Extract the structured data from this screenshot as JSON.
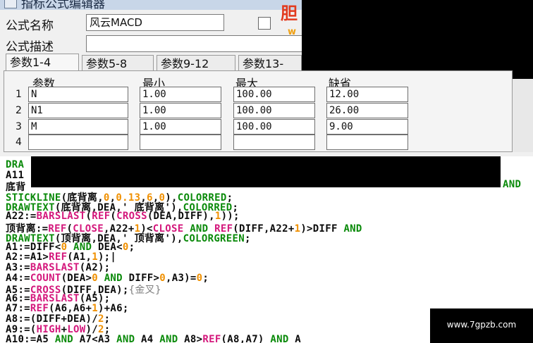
{
  "window": {
    "title": "指标公式编辑器"
  },
  "form": {
    "name_label": "公式名称",
    "name_value": "风云MACD",
    "desc_label": "公式描述",
    "desc_value": ""
  },
  "logo": {
    "text_red": "胆",
    "text_gold": "w"
  },
  "tabs": [
    {
      "label": "参数1-4",
      "active": true
    },
    {
      "label": "参数5-8",
      "active": false
    },
    {
      "label": "参数9-12",
      "active": false
    },
    {
      "label": "参数13-",
      "active": false
    }
  ],
  "params": {
    "headers": [
      "参数",
      "最小",
      "最大",
      "缺省"
    ],
    "rows": [
      {
        "num": "1",
        "name": "N",
        "min": "1.00",
        "max": "100.00",
        "default": "12.00"
      },
      {
        "num": "2",
        "name": "N1",
        "min": "1.00",
        "max": "100.00",
        "default": "26.00"
      },
      {
        "num": "3",
        "name": "M",
        "min": "1.00",
        "max": "100.00",
        "default": "9.00"
      },
      {
        "num": "4",
        "name": "",
        "min": "",
        "max": "",
        "default": ""
      }
    ]
  },
  "colors": {
    "keyword": "#0a8a0a",
    "operator": "#0a0a0a",
    "function": "#d4187c",
    "number": "#f09000",
    "string": "#111111",
    "builtin_color": "#0a8a0a",
    "comment": "#808080"
  },
  "code": {
    "lines": [
      [
        {
          "t": "DRA",
          "c": "keyword"
        }
      ],
      [
        {
          "t": "A11",
          "c": "operator"
        }
      ],
      [
        {
          "t": "底背",
          "c": "operator"
        }
      ],
      [
        {
          "t": "STICKLINE",
          "c": "keyword"
        },
        {
          "t": "(底背离,",
          "c": "operator"
        },
        {
          "t": "0",
          "c": "number"
        },
        {
          "t": ",",
          "c": "operator"
        },
        {
          "t": "0.13",
          "c": "number"
        },
        {
          "t": ",",
          "c": "operator"
        },
        {
          "t": "6",
          "c": "number"
        },
        {
          "t": ",",
          "c": "operator"
        },
        {
          "t": "0",
          "c": "number"
        },
        {
          "t": "),",
          "c": "operator"
        },
        {
          "t": "COLORRED",
          "c": "builtin_color"
        },
        {
          "t": ";",
          "c": "operator"
        }
      ],
      [
        {
          "t": "DRAWTEXT",
          "c": "keyword"
        },
        {
          "t": "(底背离,DEA,' 底背离'),",
          "c": "operator"
        },
        {
          "t": "COLORRED",
          "c": "builtin_color"
        },
        {
          "t": ";",
          "c": "operator"
        }
      ],
      [
        {
          "t": "A22:=",
          "c": "operator"
        },
        {
          "t": "BARSLAST",
          "c": "function"
        },
        {
          "t": "(",
          "c": "operator"
        },
        {
          "t": "REF",
          "c": "function"
        },
        {
          "t": "(",
          "c": "operator"
        },
        {
          "t": "CROSS",
          "c": "function"
        },
        {
          "t": "(DEA,DIFF),",
          "c": "operator"
        },
        {
          "t": "1",
          "c": "number"
        },
        {
          "t": "));",
          "c": "operator"
        }
      ],
      [
        {
          "t": "顶背离:=",
          "c": "operator"
        },
        {
          "t": "REF",
          "c": "function"
        },
        {
          "t": "(",
          "c": "operator"
        },
        {
          "t": "CLOSE",
          "c": "function"
        },
        {
          "t": ",A22+",
          "c": "operator"
        },
        {
          "t": "1",
          "c": "number"
        },
        {
          "t": ")<",
          "c": "operator"
        },
        {
          "t": "CLOSE",
          "c": "function"
        },
        {
          "t": " ",
          "c": "operator"
        },
        {
          "t": "AND",
          "c": "keyword"
        },
        {
          "t": " ",
          "c": "operator"
        },
        {
          "t": "REF",
          "c": "function"
        },
        {
          "t": "(DIFF,A22+",
          "c": "operator"
        },
        {
          "t": "1",
          "c": "number"
        },
        {
          "t": ")>DIFF ",
          "c": "operator"
        },
        {
          "t": "AND",
          "c": "keyword"
        }
      ],
      [
        {
          "t": "DRAWTEXT",
          "c": "keyword"
        },
        {
          "t": "(顶背离,DEA,' 顶背离'),",
          "c": "operator"
        },
        {
          "t": "COLORGREEN",
          "c": "builtin_color"
        },
        {
          "t": ";",
          "c": "operator"
        }
      ],
      [
        {
          "t": "A1:=DIFF<",
          "c": "operator"
        },
        {
          "t": "0",
          "c": "number"
        },
        {
          "t": " ",
          "c": "operator"
        },
        {
          "t": "AND",
          "c": "keyword"
        },
        {
          "t": " DEA<",
          "c": "operator"
        },
        {
          "t": "0",
          "c": "number"
        },
        {
          "t": ";",
          "c": "operator"
        }
      ],
      [
        {
          "t": "A2:=A1>",
          "c": "operator"
        },
        {
          "t": "REF",
          "c": "function"
        },
        {
          "t": "(A1,",
          "c": "operator"
        },
        {
          "t": "1",
          "c": "number"
        },
        {
          "t": ");|",
          "c": "operator"
        }
      ],
      [
        {
          "t": "A3:=",
          "c": "operator"
        },
        {
          "t": "BARSLAST",
          "c": "function"
        },
        {
          "t": "(A2);",
          "c": "operator"
        }
      ],
      [
        {
          "t": "A4:=",
          "c": "operator"
        },
        {
          "t": "COUNT",
          "c": "function"
        },
        {
          "t": "(DEA>",
          "c": "operator"
        },
        {
          "t": "0",
          "c": "number"
        },
        {
          "t": " ",
          "c": "operator"
        },
        {
          "t": "AND",
          "c": "keyword"
        },
        {
          "t": " DIFF>",
          "c": "operator"
        },
        {
          "t": "0",
          "c": "number"
        },
        {
          "t": ",A3)=",
          "c": "operator"
        },
        {
          "t": "0",
          "c": "number"
        },
        {
          "t": ";",
          "c": "operator"
        }
      ],
      [
        {
          "t": "A5:=",
          "c": "operator"
        },
        {
          "t": "CROSS",
          "c": "function"
        },
        {
          "t": "(DIFF,DEA);",
          "c": "operator"
        },
        {
          "t": "{金叉}",
          "c": "comment"
        }
      ],
      [
        {
          "t": "A6:=",
          "c": "operator"
        },
        {
          "t": "BARSLAST",
          "c": "function"
        },
        {
          "t": "(A5);",
          "c": "operator"
        }
      ],
      [
        {
          "t": "A7:=",
          "c": "operator"
        },
        {
          "t": "REF",
          "c": "function"
        },
        {
          "t": "(A6,A6+",
          "c": "operator"
        },
        {
          "t": "1",
          "c": "number"
        },
        {
          "t": ")+A6;",
          "c": "operator"
        }
      ],
      [
        {
          "t": "A8:=(DIFF+DEA)/",
          "c": "operator"
        },
        {
          "t": "2",
          "c": "number"
        },
        {
          "t": ";",
          "c": "operator"
        }
      ],
      [
        {
          "t": "A9:=(",
          "c": "operator"
        },
        {
          "t": "HIGH",
          "c": "function"
        },
        {
          "t": "+",
          "c": "operator"
        },
        {
          "t": "LOW",
          "c": "function"
        },
        {
          "t": ")/",
          "c": "operator"
        },
        {
          "t": "2",
          "c": "number"
        },
        {
          "t": ";",
          "c": "operator"
        }
      ],
      [
        {
          "t": "A10:=A5 ",
          "c": "operator"
        },
        {
          "t": "AND",
          "c": "keyword"
        },
        {
          "t": " A7<A3 ",
          "c": "operator"
        },
        {
          "t": "AND",
          "c": "keyword"
        },
        {
          "t": " A4 ",
          "c": "operator"
        },
        {
          "t": "AND",
          "c": "keyword"
        },
        {
          "t": " A8>",
          "c": "operator"
        },
        {
          "t": "REF",
          "c": "function"
        },
        {
          "t": "(A8,A7) ",
          "c": "operator"
        },
        {
          "t": "AND",
          "c": "keyword"
        },
        {
          "t": " A",
          "c": "operator"
        }
      ]
    ],
    "overflow_right": "AND"
  },
  "watermark": {
    "text": "www.7gpzb.com"
  }
}
